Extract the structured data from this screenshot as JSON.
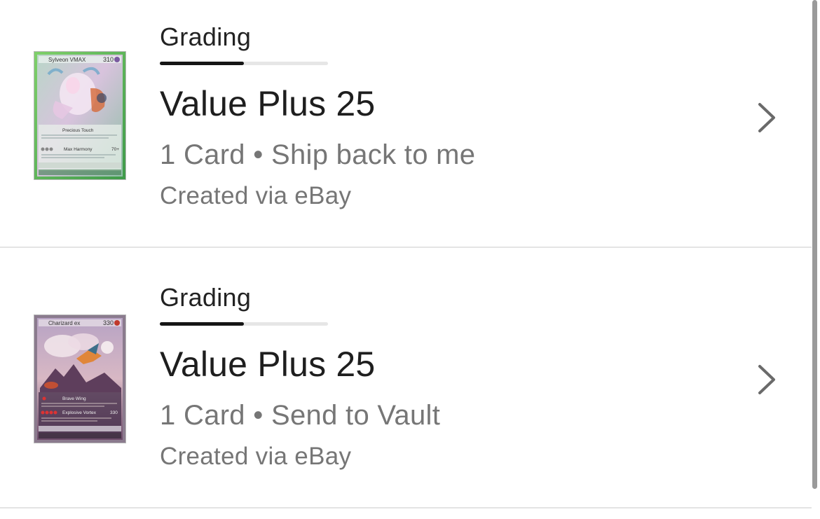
{
  "orders": [
    {
      "status": "Grading",
      "progress": 0.5,
      "service": "Value Plus 25",
      "card_count": "1 Card",
      "separator": "•",
      "shipping": "Ship back to me",
      "source": "Created via eBay",
      "card": {
        "name": "Sylveon VMAX",
        "hp": "310",
        "attack_1": "Precious Touch",
        "attack_2": "Max Harmony",
        "attack_2_damage": "70+"
      }
    },
    {
      "status": "Grading",
      "progress": 0.5,
      "service": "Value Plus 25",
      "card_count": "1 Card",
      "separator": "•",
      "shipping": "Send to Vault",
      "source": "Created via eBay",
      "card": {
        "name": "Charizard ex",
        "hp": "330",
        "attack_1": "Brave Wing",
        "attack_2": "Explosive Vortex",
        "attack_2_damage": "330"
      }
    }
  ],
  "icons": {
    "chevron": "chevron-right-icon"
  },
  "colors": {
    "progress_fill": "#151515",
    "progress_track": "#e6e6e6",
    "secondary_text": "#767676"
  }
}
